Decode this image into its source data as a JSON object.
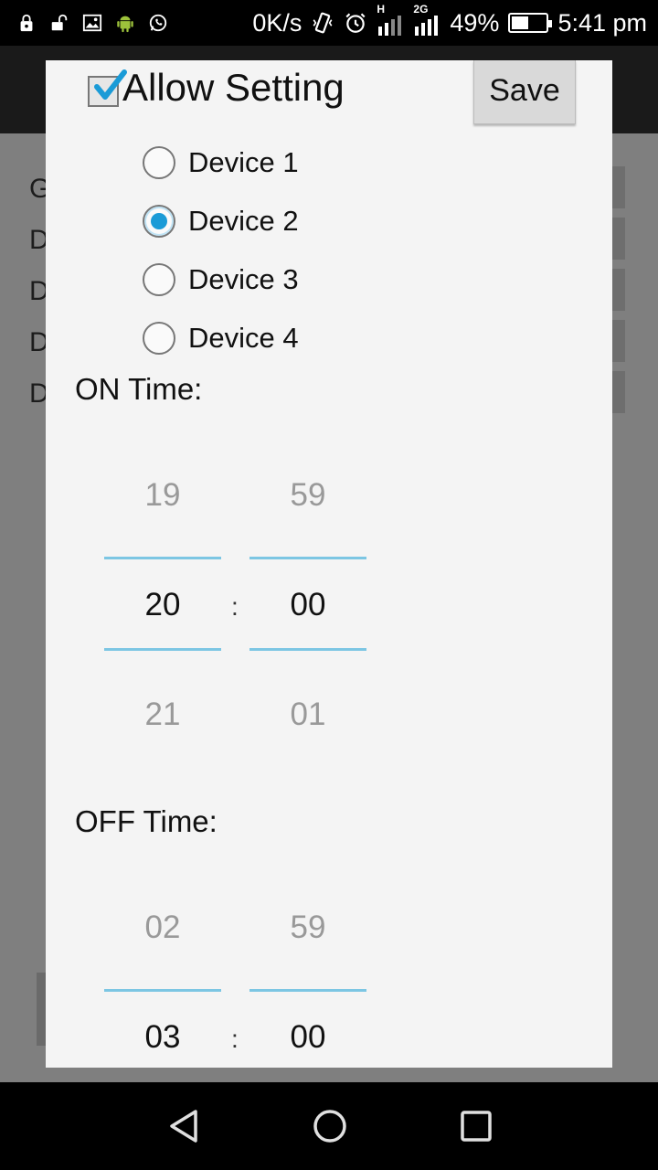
{
  "status_bar": {
    "left_icons": [
      "lock-icon",
      "unlock-icon",
      "image-icon",
      "android-icon",
      "whatsapp-icon"
    ],
    "net_speed": "0K/s",
    "network_h": "H",
    "network_2g": "2G",
    "battery": "49%",
    "battery_level": 0.49,
    "time": "5:41 pm"
  },
  "background": {
    "rows": [
      "G",
      "D",
      "D",
      "D",
      "D"
    ]
  },
  "dialog": {
    "allow_label": "Allow Setting",
    "allow_checked": true,
    "save_label": "Save",
    "devices": [
      {
        "label": "Device 1",
        "checked": false
      },
      {
        "label": "Device 2",
        "checked": true
      },
      {
        "label": "Device 3",
        "checked": false
      },
      {
        "label": "Device 4",
        "checked": false
      }
    ],
    "on_time": {
      "label": "ON Time:",
      "hour_prev": "19",
      "hour": "20",
      "hour_next": "21",
      "minute_prev": "59",
      "minute": "00",
      "minute_next": "01",
      "separator": ":"
    },
    "off_time": {
      "label": "OFF Time:",
      "hour_prev": "02",
      "hour": "03",
      "minute_prev": "59",
      "minute": "00",
      "separator": ":"
    },
    "accent_color": "#1a9bd7"
  }
}
